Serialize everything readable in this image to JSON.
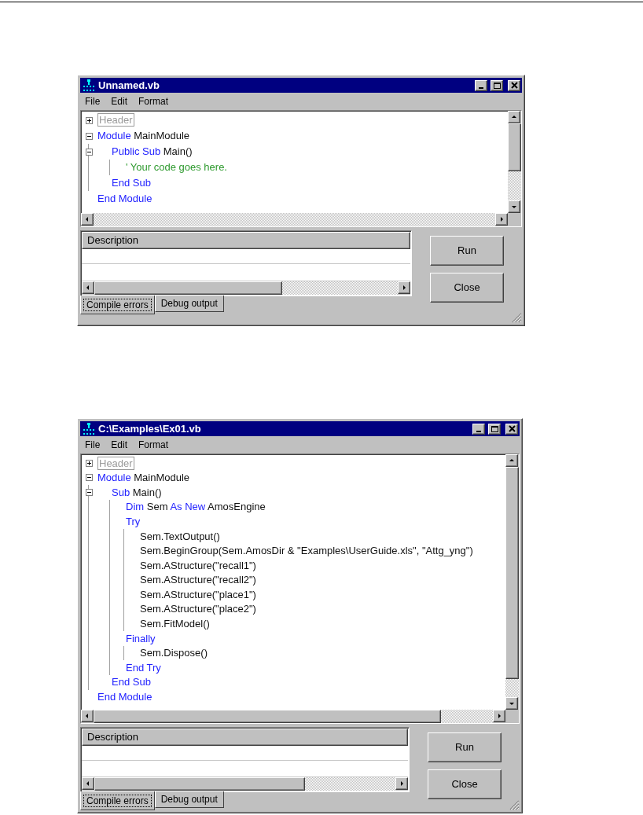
{
  "windows": [
    {
      "title": "Unnamed.vb",
      "menu": [
        "File",
        "Edit",
        "Format"
      ],
      "code": [
        {
          "tokens": [
            {
              "kind": "header",
              "text": "Header"
            }
          ],
          "expanded": false
        },
        {
          "tokens": [
            {
              "kind": "keyword",
              "text": "Module"
            },
            {
              "kind": "plain",
              "text": "MainModule"
            }
          ],
          "expanded": true,
          "children": [
            {
              "tokens": [
                {
                  "kind": "keyword",
                  "text": "Public Sub"
                },
                {
                  "kind": "plain",
                  "text": "Main()"
                }
              ],
              "expanded": true,
              "children": [
                {
                  "tokens": [
                    {
                      "kind": "comment",
                      "text": "' Your code goes here."
                    }
                  ]
                }
              ]
            },
            {
              "tokens": [
                {
                  "kind": "keyword",
                  "text": "End Sub"
                }
              ]
            }
          ]
        },
        {
          "tokens": [
            {
              "kind": "keyword",
              "text": "End Module"
            }
          ]
        }
      ],
      "errors_list": {
        "columns": [
          "Description"
        ]
      },
      "tabs": [
        {
          "label": "Compile errors",
          "selected": true
        },
        {
          "label": "Debug output",
          "selected": false
        }
      ],
      "buttons": [
        "Run",
        "Close"
      ]
    },
    {
      "title": "C:\\Examples\\Ex01.vb",
      "menu": [
        "File",
        "Edit",
        "Format"
      ],
      "code": [
        {
          "tokens": [
            {
              "kind": "header",
              "text": "Header"
            }
          ],
          "expanded": false
        },
        {
          "tokens": [
            {
              "kind": "keyword",
              "text": "Module"
            },
            {
              "kind": "plain",
              "text": "MainModule"
            }
          ],
          "expanded": true,
          "children": [
            {
              "tokens": [
                {
                  "kind": "keyword",
                  "text": "Sub"
                },
                {
                  "kind": "plain",
                  "text": "Main()"
                }
              ],
              "expanded": true,
              "children": [
                {
                  "tokens": [
                    {
                      "kind": "keyword",
                      "text": "Dim"
                    },
                    {
                      "kind": "plain",
                      "text": "Sem"
                    },
                    {
                      "kind": "keyword",
                      "text": "As New"
                    },
                    {
                      "kind": "plain",
                      "text": "AmosEngine"
                    }
                  ]
                },
                {
                  "tokens": [
                    {
                      "kind": "keyword",
                      "text": "Try"
                    }
                  ],
                  "children": [
                    {
                      "tokens": [
                        {
                          "kind": "plain",
                          "text": "Sem.TextOutput()"
                        }
                      ]
                    },
                    {
                      "tokens": [
                        {
                          "kind": "plain",
                          "text": "Sem.BeginGroup(Sem.AmosDir & \"Examples\\UserGuide.xls\", \"Attg_yng\")"
                        }
                      ]
                    },
                    {
                      "tokens": [
                        {
                          "kind": "plain",
                          "text": "Sem.AStructure(\"recall1\")"
                        }
                      ]
                    },
                    {
                      "tokens": [
                        {
                          "kind": "plain",
                          "text": "Sem.AStructure(\"recall2\")"
                        }
                      ]
                    },
                    {
                      "tokens": [
                        {
                          "kind": "plain",
                          "text": "Sem.AStructure(\"place1\")"
                        }
                      ]
                    },
                    {
                      "tokens": [
                        {
                          "kind": "plain",
                          "text": "Sem.AStructure(\"place2\")"
                        }
                      ]
                    },
                    {
                      "tokens": [
                        {
                          "kind": "plain",
                          "text": "Sem.FitModel()"
                        }
                      ]
                    }
                  ]
                },
                {
                  "tokens": [
                    {
                      "kind": "keyword",
                      "text": "Finally"
                    }
                  ],
                  "children": [
                    {
                      "tokens": [
                        {
                          "kind": "plain",
                          "text": "Sem.Dispose()"
                        }
                      ]
                    }
                  ]
                },
                {
                  "tokens": [
                    {
                      "kind": "keyword",
                      "text": "End Try"
                    }
                  ]
                }
              ]
            },
            {
              "tokens": [
                {
                  "kind": "keyword",
                  "text": "End Sub"
                }
              ]
            }
          ]
        },
        {
          "tokens": [
            {
              "kind": "keyword",
              "text": "End Module"
            }
          ]
        }
      ],
      "errors_list": {
        "columns": [
          "Description"
        ]
      },
      "tabs": [
        {
          "label": "Compile errors",
          "selected": true
        },
        {
          "label": "Debug output",
          "selected": false
        }
      ],
      "buttons": [
        "Run",
        "Close"
      ]
    }
  ]
}
